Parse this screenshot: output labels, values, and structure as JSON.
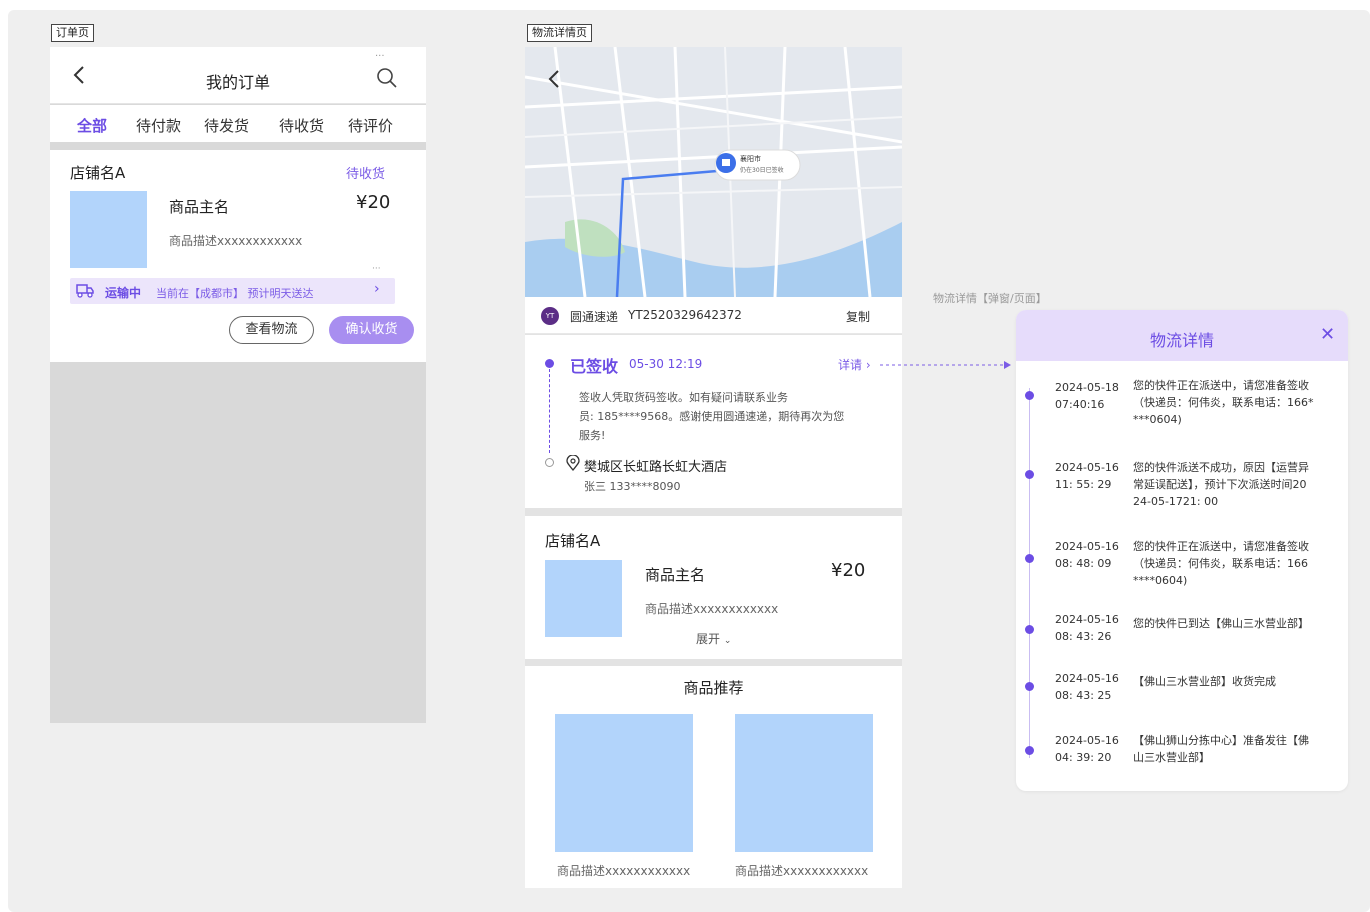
{
  "labels": {
    "order_page": "订单页",
    "logistics_page": "物流详情页",
    "popup_note": "物流详情【弹窗/页面】"
  },
  "order_page": {
    "title": "我的订单",
    "tabs": [
      "全部",
      "待付款",
      "待发货",
      "待收货",
      "待评价"
    ],
    "shop_name": "店铺名A",
    "status": "待收货",
    "product_name": "商品主名",
    "price": "¥20",
    "description": "商品描述xxxxxxxxxxxx",
    "shipping_status": "运输中",
    "shipping_info": "当前在【成都市】 预计明天送达",
    "btn_view_logistics": "查看物流",
    "btn_confirm": "确认收货"
  },
  "logistics_page": {
    "map_pin_city": "襄阳市",
    "map_pin_sub": "仍在30日已签收",
    "carrier_logo": "YT",
    "carrier_name": "圆通速递",
    "tracking_no": "YT2520329642372",
    "copy_label": "复制",
    "signed_status": "已签收",
    "signed_time": "05-30 12:19",
    "detail_link": "详请",
    "signed_msg_1": "签收人凭取货码签收。如有疑问请联系业务",
    "signed_msg_2": "员: 185****9568。感谢使用圆通速递，期待再次为您",
    "signed_msg_3": "服务!",
    "address": "樊城区长虹路长虹大酒店",
    "receiver": "张三  133****8090",
    "shop_name": "店铺名A",
    "product_name": "商品主名",
    "price": "¥20",
    "description": "商品描述xxxxxxxxxxxx",
    "expand_label": "展开",
    "rec_title": "商品推荐",
    "rec_items": [
      "商品描述xxxxxxxxxxxx",
      "商品描述xxxxxxxxxxxx"
    ]
  },
  "popup": {
    "title": "物流详情",
    "entries": [
      {
        "date": "2024-05-18",
        "time": "07:40:16",
        "lines": [
          "您的快件正在派送中，请您准备签收",
          "（快递员：何伟炎，联系电话：166*",
          "***0604)"
        ]
      },
      {
        "date": "2024-05-16",
        "time": "11: 55: 29",
        "lines": [
          "您的快件派送不成功，原因【运营异",
          "常延误配送】，预计下次派送时间20",
          "24-05-1721: 00"
        ]
      },
      {
        "date": "2024-05-16",
        "time": "08: 48: 09",
        "lines": [
          "您的快件正在派送中，请您准备签收",
          "（快递员：何伟炎，联系电话：166",
          "****0604)"
        ]
      },
      {
        "date": "2024-05-16",
        "time": "08: 43: 26",
        "lines": [
          "您的快件已到达【佛山三水营业部】"
        ]
      },
      {
        "date": "2024-05-16",
        "time": "08: 43: 25",
        "lines": [
          "【佛山三水营业部】收货完成"
        ]
      },
      {
        "date": "2024-05-16",
        "time": "04: 39: 20",
        "lines": [
          "【佛山狮山分拣中心】准备发往【佛",
          "山三水营业部】"
        ]
      }
    ]
  },
  "colors": {
    "accent": "#6c4de4",
    "accent_light": "#e6dcfb",
    "thumb": "#b2d4fb"
  },
  "icons": [
    "back-icon",
    "search-icon",
    "truck-icon",
    "chevron-right-icon",
    "location-pin-icon",
    "close-icon",
    "chevron-down-icon"
  ]
}
